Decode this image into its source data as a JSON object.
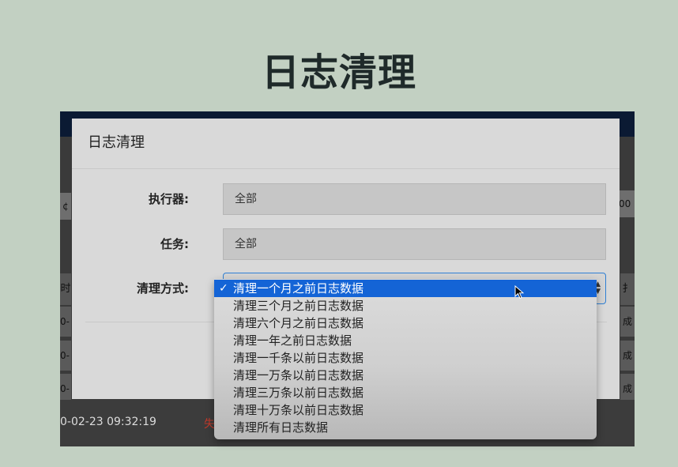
{
  "page_title": "日志清理",
  "background_app": {
    "filter_left_glyph": "¢",
    "filter_right_text": "00",
    "column_left_text": "时",
    "column_right_text": "扌",
    "rows": [
      {
        "time_fragment": "0-(",
        "status_fragment": "成"
      },
      {
        "time_fragment": "0-(",
        "status_fragment": "成"
      },
      {
        "time_fragment": "0-(",
        "status_fragment": "成"
      }
    ],
    "bottom_row": {
      "time": "0-02-23 09:32:19",
      "status_fragment": "失"
    }
  },
  "modal": {
    "title": "日志清理",
    "fields": {
      "executor": {
        "label": "执行器:",
        "value": "全部"
      },
      "task": {
        "label": "任务:",
        "value": "全部"
      },
      "clean_type": {
        "label": "清理方式:"
      }
    }
  },
  "dropdown": {
    "selected_index": 0,
    "options": [
      "清理一个月之前日志数据",
      "清理三个月之前日志数据",
      "清理六个月之前日志数据",
      "清理一年之前日志数据",
      "清理一千条以前日志数据",
      "清理一万条以前日志数据",
      "清理三万条以前日志数据",
      "清理十万条以前日志数据",
      "清理所有日志数据"
    ]
  },
  "colors": {
    "page_background": "#c2d0c2",
    "highlight": "#1464d6",
    "topbar": "#0b1a33",
    "error": "#c0392b"
  },
  "icons": {
    "check": "check-icon",
    "select_arrows": "select-arrows-icon",
    "cursor": "mouse-cursor-icon"
  }
}
